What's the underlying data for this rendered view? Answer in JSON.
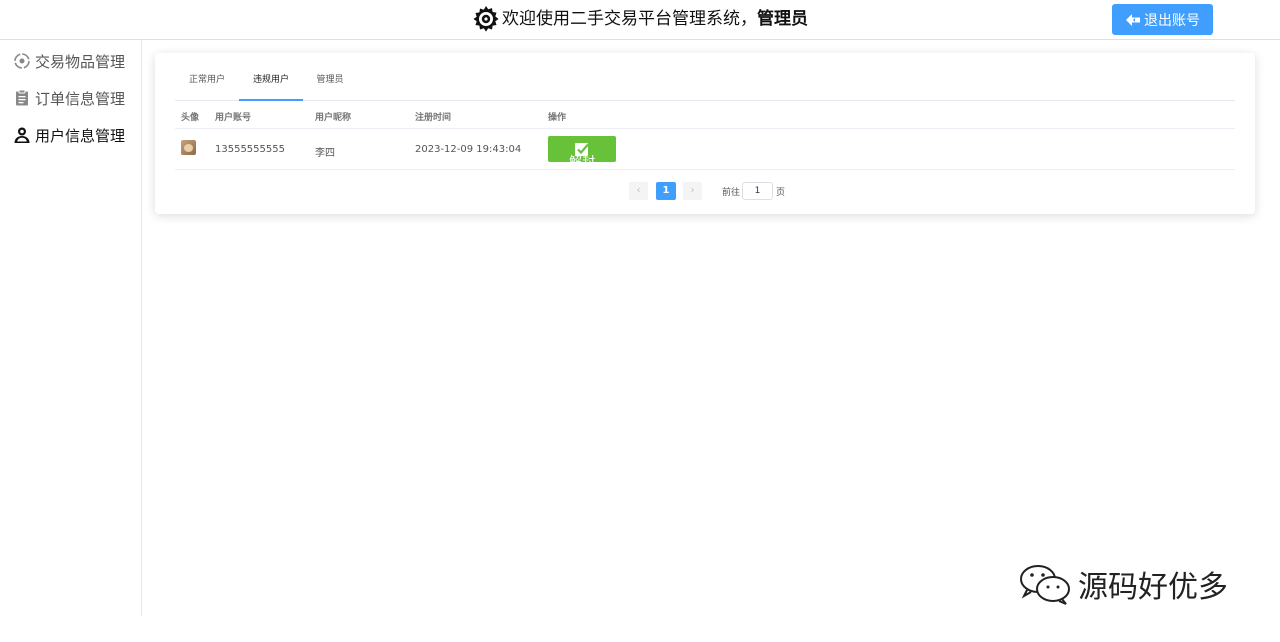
{
  "header": {
    "title_prefix": "欢迎使用二手交易平台管理系统，",
    "role": "管理员",
    "logout_label": "退出账号"
  },
  "sidebar": {
    "items": [
      {
        "label": "交易物品管理",
        "icon": "item-icon",
        "active": false
      },
      {
        "label": "订单信息管理",
        "icon": "clipboard-icon",
        "active": false
      },
      {
        "label": "用户信息管理",
        "icon": "user-icon",
        "active": true
      }
    ]
  },
  "tabs": [
    {
      "label": "正常用户",
      "active": false
    },
    {
      "label": "违规用户",
      "active": true
    },
    {
      "label": "管理员",
      "active": false
    }
  ],
  "table": {
    "columns": [
      "头像",
      "用户账号",
      "用户昵称",
      "注册时间",
      "操作"
    ],
    "rows": [
      {
        "account": "13555555555",
        "nickname": "李四",
        "registered": "2023-12-09 19:43:04",
        "action_label": "解封"
      }
    ]
  },
  "pagination": {
    "prev": "‹",
    "current_page": "1",
    "next": "›",
    "goto_prefix": "前往",
    "goto_value": "1",
    "goto_suffix": "页"
  },
  "watermark": {
    "text": "源码好优多"
  },
  "colors": {
    "primary": "#409eff",
    "success": "#67c23a"
  }
}
